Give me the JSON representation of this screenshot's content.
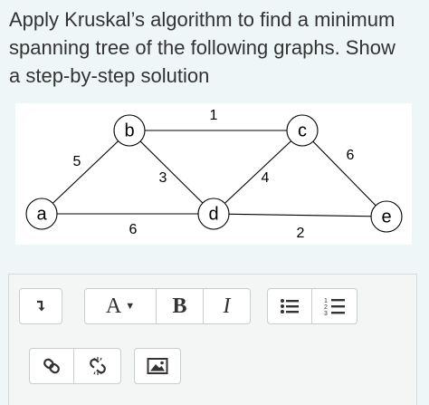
{
  "question": {
    "line1": "Apply Kruskal’s algorithm to find a minimum",
    "line2": "spanning tree of the following graphs. Show",
    "line3": "a step-by-step solution"
  },
  "graph": {
    "nodes": [
      {
        "id": "a",
        "label": "a"
      },
      {
        "id": "b",
        "label": "b"
      },
      {
        "id": "c",
        "label": "c"
      },
      {
        "id": "d",
        "label": "d"
      },
      {
        "id": "e",
        "label": "e"
      }
    ],
    "edges": [
      {
        "from": "b",
        "to": "c",
        "weight": "1"
      },
      {
        "from": "a",
        "to": "b",
        "weight": "5"
      },
      {
        "from": "b",
        "to": "d",
        "weight": "3"
      },
      {
        "from": "c",
        "to": "d",
        "weight": "4"
      },
      {
        "from": "c",
        "to": "e",
        "weight": "6"
      },
      {
        "from": "a",
        "to": "d",
        "weight": "6"
      },
      {
        "from": "d",
        "to": "e",
        "weight": "2"
      }
    ]
  },
  "toolbar": {
    "font_label": "A",
    "bold_label": "B",
    "italic_label": "I",
    "icons": [
      "expand-toggle-icon",
      "font-dropdown-caret-icon",
      "bullet-list-icon",
      "numbered-list-icon",
      "link-icon",
      "unlink-icon",
      "image-icon"
    ]
  },
  "colors": {
    "background": "#eef6f8",
    "text": "#333333",
    "toolbar_bg": "#f4f5f5",
    "border": "#c9cdcf"
  }
}
